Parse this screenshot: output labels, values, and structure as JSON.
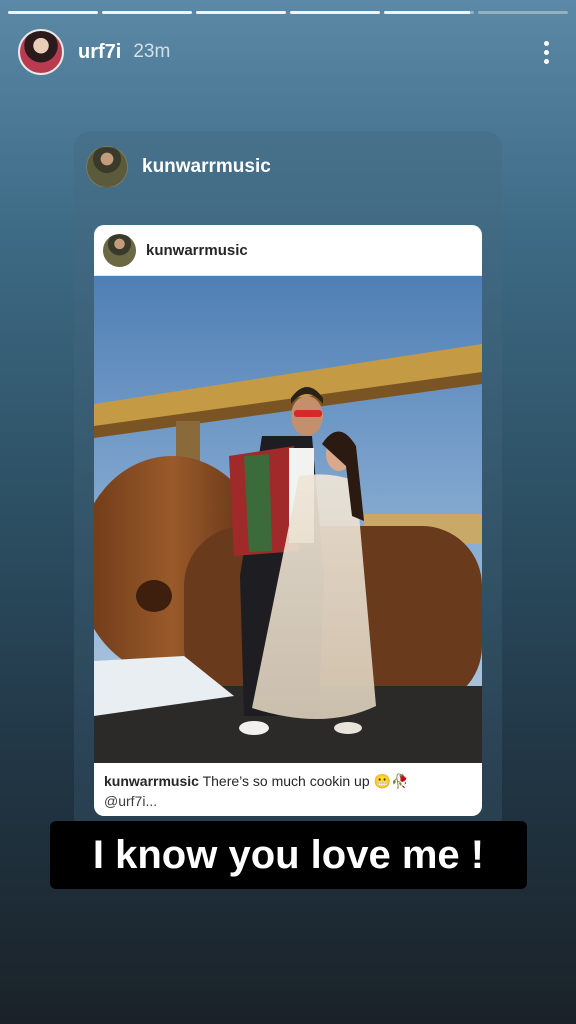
{
  "story": {
    "progress": [
      1,
      1,
      1,
      1,
      0.95,
      0
    ],
    "username": "urf7i",
    "time": "23m",
    "more_icon": "vertical-ellipsis-icon"
  },
  "shared_post": {
    "card_username": "kunwarrmusic",
    "post_username": "kunwarrmusic",
    "caption_user": "kunwarrmusic",
    "caption_text": " There’s so much cookin up 😬🥀",
    "caption_mention": "@urf7i..."
  },
  "overlay": {
    "text": "I know you love me !"
  },
  "colors": {
    "caption_text": "#262626",
    "overlay_bg": "#000000"
  }
}
